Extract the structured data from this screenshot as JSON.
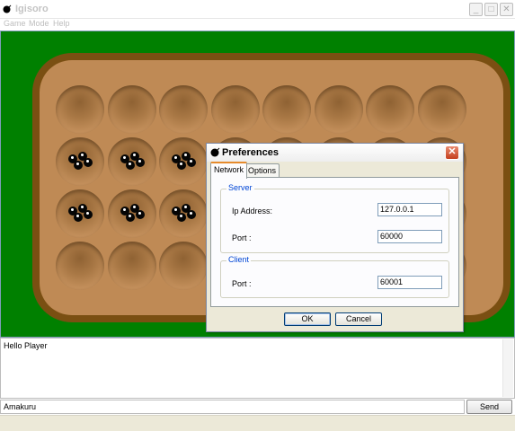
{
  "window": {
    "title": "Igisoro",
    "icon": "bomb-icon"
  },
  "titlebar_buttons": [
    {
      "name": "minimize-button",
      "icon": "minimize-icon",
      "glyph": "_"
    },
    {
      "name": "maximize-button",
      "icon": "maximize-icon",
      "glyph": "□"
    },
    {
      "name": "close-button",
      "icon": "close-icon",
      "glyph": "✕"
    }
  ],
  "menu": [
    "Game",
    "Mode",
    "Help"
  ],
  "board": {
    "rows": 4,
    "columns": 8,
    "seeds_per_pit": [
      [
        0,
        0,
        0,
        0,
        0,
        0,
        0,
        0
      ],
      [
        4,
        4,
        4,
        0,
        0,
        0,
        0,
        0
      ],
      [
        4,
        4,
        4,
        0,
        0,
        0,
        0,
        0
      ],
      [
        0,
        0,
        0,
        0,
        0,
        0,
        0,
        0
      ]
    ],
    "colors": {
      "background": "#008000",
      "rim": "#7a4f12",
      "wood": "#bf8a55"
    }
  },
  "chat": {
    "messages": [
      "Hello Player"
    ],
    "input_value": "Amakuru",
    "send_label": "Send"
  },
  "dialog": {
    "title": "Preferences",
    "icon": "bomb-icon",
    "tabs": [
      {
        "label": "Network",
        "active": true
      },
      {
        "label": "Options",
        "active": false
      }
    ],
    "server": {
      "legend": "Server",
      "ip_label": "Ip Address:",
      "ip_value": "127.0.0.1",
      "port_label": "Port :",
      "port_value": "60000"
    },
    "client": {
      "legend": "Client",
      "port_label": "Port :",
      "port_value": "60001"
    },
    "ok_label": "OK",
    "cancel_label": "Cancel",
    "colors": {
      "tab_highlight": "#e68b2c",
      "legend": "#0046d5",
      "close": "#c4401f"
    }
  }
}
